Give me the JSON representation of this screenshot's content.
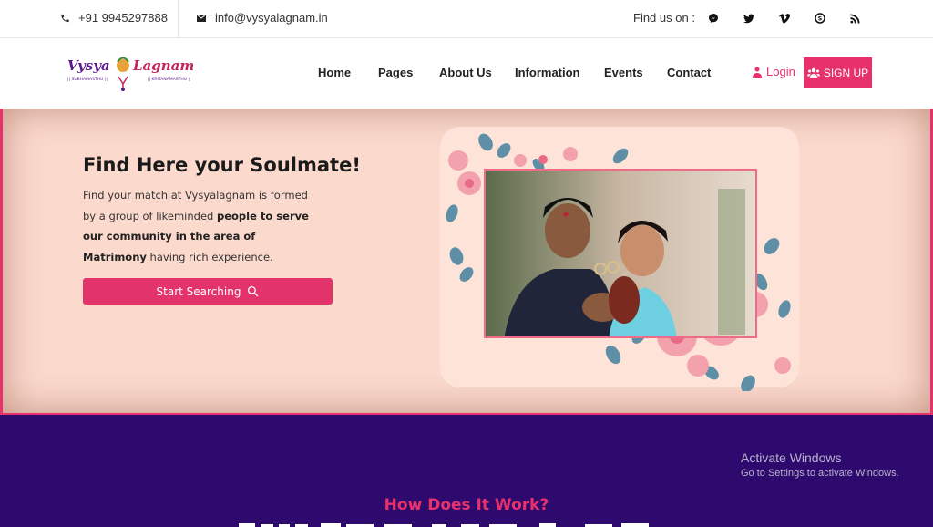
{
  "topbar": {
    "phone": "+91 9945297888",
    "email": "info@vysyalagnam.in",
    "find_us": "Find us on :",
    "social_icons": [
      "messenger-icon",
      "twitter-icon",
      "vimeo-icon",
      "skype-icon",
      "rss-icon"
    ]
  },
  "header": {
    "logo": {
      "brand_left": "Vysya",
      "brand_right": "Lagnam",
      "tag_left": "|| SUBHAMASTHU ||",
      "tag_right": "|| KRITANAMASTHU ||"
    },
    "nav": [
      "Home",
      "Pages",
      "About Us",
      "Information",
      "Events",
      "Contact"
    ],
    "login_label": "Login",
    "signup_label": "SIGN UP"
  },
  "hero": {
    "title": "Find Here your Soulmate!",
    "text_1": "Find your match at Vysyalagnam is formed by a group of likeminded ",
    "text_bold": "people to serve our community in the area of Matrimony",
    "text_2": " having rich experience.",
    "search_button": "Start Searching"
  },
  "section2": {
    "heading": "How Does It Work?"
  },
  "overlay": {
    "activate_title": "Activate Windows",
    "activate_sub": "Go to Settings to activate Windows."
  },
  "colors": {
    "accent": "#e8316b",
    "hero_bg": "#fbd9cd",
    "section_bg": "#2e0a6e"
  }
}
